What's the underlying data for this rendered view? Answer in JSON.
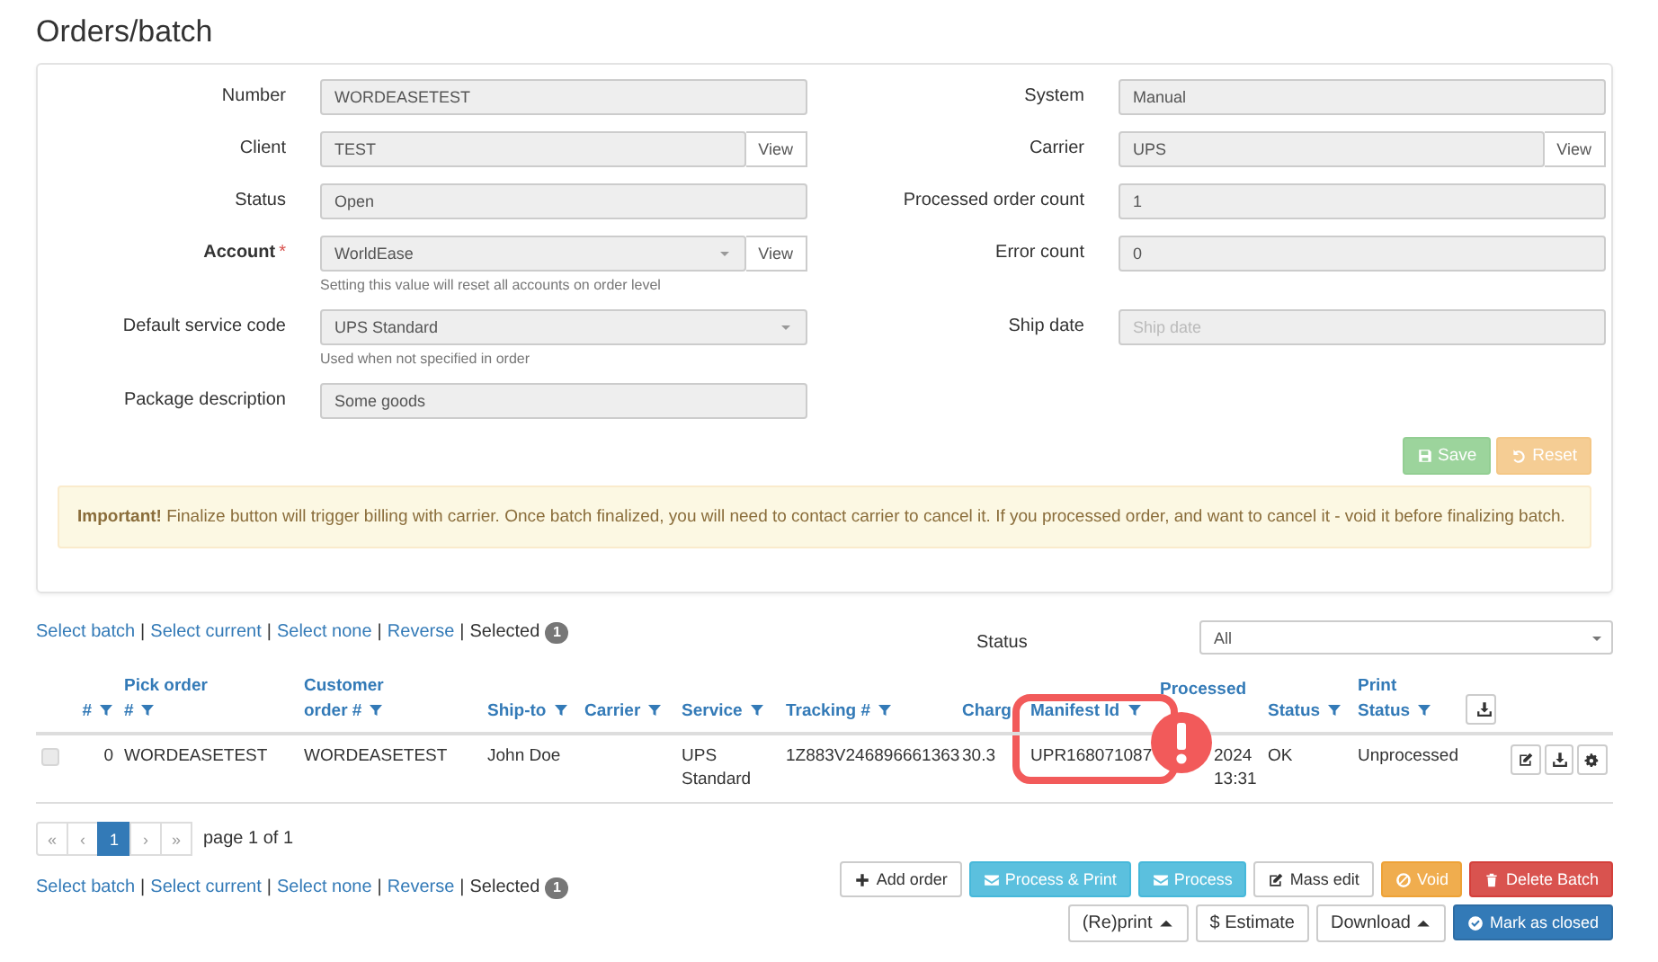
{
  "page": {
    "title": "Orders/batch"
  },
  "form": {
    "left": [
      {
        "label": "Number",
        "value": "WORDEASETEST",
        "kind": "text"
      },
      {
        "label": "Client",
        "value": "TEST",
        "kind": "text",
        "button": "View"
      },
      {
        "label": "Status",
        "value": "Open",
        "kind": "text"
      },
      {
        "label": "Account",
        "required_mark": "*",
        "value": "WorldEase",
        "kind": "select",
        "button": "View",
        "help": "Setting this value will reset all accounts on order level"
      },
      {
        "label": "Default service code",
        "value": "UPS Standard",
        "kind": "select",
        "help": "Used when not specified in order"
      },
      {
        "label": "Package description",
        "value": "Some goods",
        "kind": "text"
      }
    ],
    "right": [
      {
        "label": "System",
        "value": "Manual",
        "kind": "text"
      },
      {
        "label": "Carrier",
        "value": "UPS",
        "kind": "text",
        "button": "View"
      },
      {
        "label": "Processed order count",
        "value": "1",
        "kind": "text"
      },
      {
        "label": "Error count",
        "value": "0",
        "kind": "text"
      },
      {
        "label": "Ship date",
        "placeholder": "Ship date",
        "kind": "text"
      }
    ],
    "actions": [
      {
        "label": "Save",
        "kind": "success",
        "disabled": true
      },
      {
        "label": "Reset",
        "kind": "warning",
        "disabled": true
      }
    ]
  },
  "alert": "**Important!** Finalize button will trigger billing with carrier. Once batch finalized, you will need to contact carrier to cancel it. If you processed order, and want to cancel it - void it before finalizing batch.",
  "selection_top": {
    "links": [
      "Select batch",
      "Select current",
      "Select none",
      "Reverse"
    ],
    "separator": "|",
    "selected_label": "Selected",
    "selected_count": "1"
  },
  "status_filter": {
    "label": "Status",
    "value": "All"
  },
  "table": {
    "columns": [
      {
        "label": "#",
        "filter": true
      },
      {
        "label": "Pick order #",
        "filter": true
      },
      {
        "label": "Customer order #",
        "filter": true
      },
      {
        "label": "Ship-to",
        "filter": true
      },
      {
        "label": "Carrier",
        "filter": true
      },
      {
        "label": "Service",
        "filter": true
      },
      {
        "label": "Tracking #",
        "filter": true
      },
      {
        "label": "Charg",
        "filter": false
      },
      {
        "label": "Manifest Id",
        "filter": true
      },
      {
        "label": "Processed",
        "filter": false
      },
      {
        "label": "Status",
        "filter": true
      },
      {
        "label": "Print Status",
        "filter": true
      }
    ],
    "rows": [
      {
        "checked": false,
        "disabled": true,
        "number": "0",
        "pick_order": "WORDEASETEST",
        "customer_order": "WORDEASETEST",
        "ship_to": "John Doe",
        "service": "UPS Standard",
        "tracking": "1Z883V246896661363",
        "charge": "30.3",
        "manifest_id": "UPR168071087",
        "processed": "2024 13:31",
        "status": "OK",
        "print_status": "Unprocessed"
      }
    ]
  },
  "pager": {
    "items": [
      {
        "label": "«",
        "selected": false
      },
      {
        "label": "‹",
        "selected": false
      },
      {
        "label": "1",
        "selected": true
      },
      {
        "label": "›",
        "selected": false
      },
      {
        "label": "»",
        "selected": false
      }
    ],
    "info": "page 1 of 1"
  },
  "selection_bottom": {
    "links": [
      "Select batch",
      "Select current",
      "Select none",
      "Reverse"
    ],
    "separator": "|",
    "selected_label": "Selected",
    "selected_count": "1"
  },
  "batch_actions": [
    [
      {
        "label": "Add order",
        "kind": "default"
      },
      {
        "label": "Process & Print",
        "kind": "info"
      },
      {
        "label": "Process",
        "kind": "info"
      },
      {
        "label": "Mass edit",
        "kind": "default"
      },
      {
        "label": "Void",
        "kind": "warning"
      },
      {
        "label": "Delete Batch",
        "kind": "danger"
      }
    ],
    [
      {
        "label": "(Re)print",
        "kind": "default"
      },
      {
        "label": "$ Estimate",
        "kind": "default"
      },
      {
        "label": "Download",
        "kind": "default"
      },
      {
        "label": "Mark as closed",
        "kind": "primary"
      }
    ]
  ]
}
